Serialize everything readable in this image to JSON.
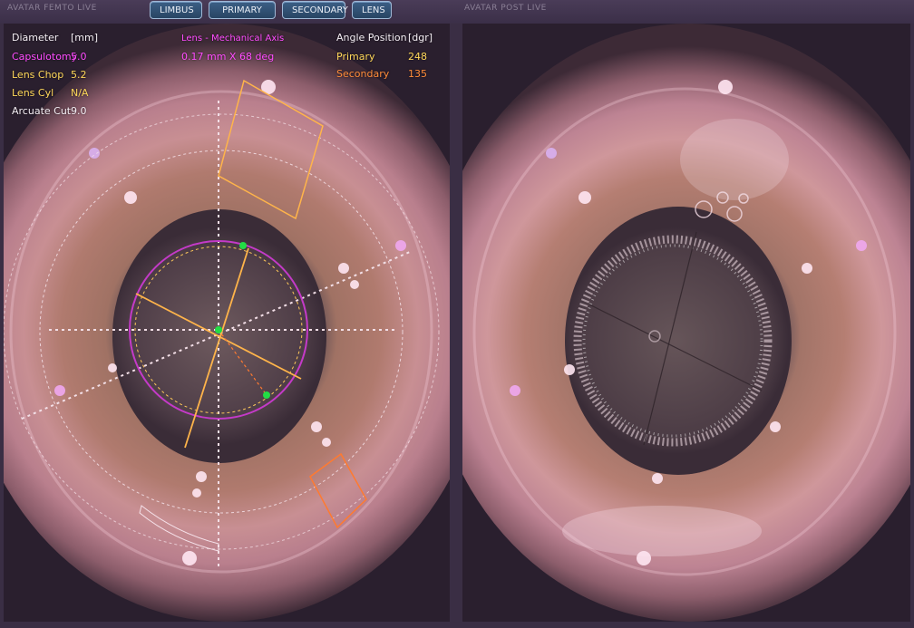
{
  "header": {
    "left_panel_label": "AVATAR FEMTO LIVE",
    "right_panel_label": "AVATAR POST LIVE",
    "tabs": [
      {
        "label": "LIMBUS"
      },
      {
        "label": "PRIMARY INCISION"
      },
      {
        "label": "SECONDARY INCISION"
      },
      {
        "label": "LENS"
      }
    ]
  },
  "diameter_table": {
    "header_label": "Diameter",
    "header_unit": "[mm]",
    "rows": [
      {
        "label": "Capsulotomy",
        "value": "5.0"
      },
      {
        "label": "Lens Chop",
        "value": "5.2"
      },
      {
        "label": "Lens Cyl",
        "value": "N/A"
      },
      {
        "label": "Arcuate Cut",
        "value": "9.0"
      }
    ]
  },
  "lens_info": {
    "title": "Lens - Mechanical Axis",
    "value": "0.17 mm X 68 deg"
  },
  "angle_table": {
    "header_label": "Angle Position",
    "header_unit": "[dgr]",
    "rows": [
      {
        "label": "Primary",
        "value": "248"
      },
      {
        "label": "Secondary",
        "value": "135"
      }
    ]
  },
  "colors": {
    "magenta": "#ff4cff",
    "yellow": "#ffd85a",
    "orange": "#ff8c3a",
    "green": "#22dd44",
    "tab_blue": "#2f5276"
  }
}
